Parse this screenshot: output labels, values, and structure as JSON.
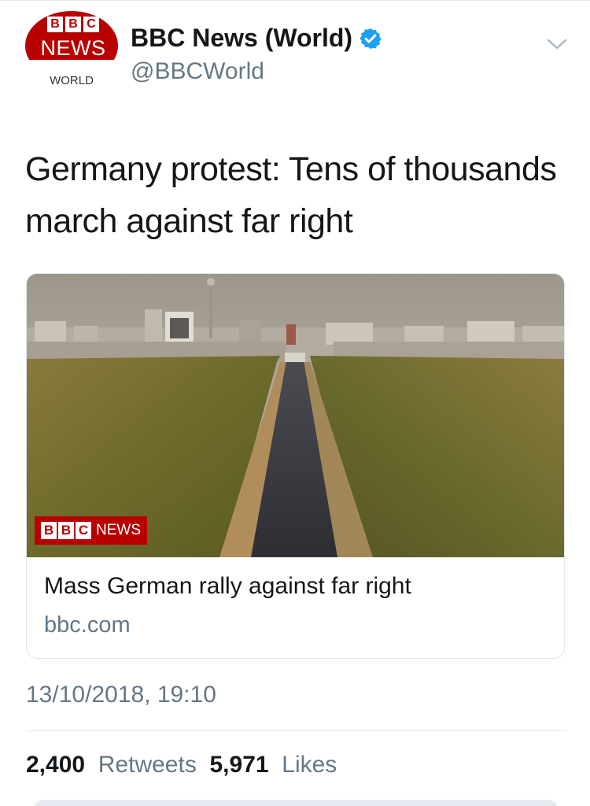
{
  "account": {
    "logo": {
      "top": "BBC",
      "middle": "NEWS",
      "bottom": "WORLD"
    },
    "display_name": "BBC News (World)",
    "handle": "@BBCWorld",
    "verified_icon": "verified-badge-icon",
    "menu_icon": "chevron-down-icon"
  },
  "tweet": {
    "text": "Germany protest: Tens of thousands march against far right"
  },
  "card": {
    "image_badge": {
      "letters": [
        "B",
        "B",
        "C"
      ],
      "word": "NEWS"
    },
    "title": "Mass German rally against far right",
    "domain": "bbc.com"
  },
  "timestamp": "13/10/2018, 19:10",
  "stats": {
    "retweets_count": "2,400",
    "retweets_label": "Retweets",
    "likes_count": "5,971",
    "likes_label": "Likes"
  },
  "colors": {
    "bbc_red": "#b80000",
    "verified_blue": "#1da1f2",
    "secondary_text": "#657786",
    "border": "#e1e8ed"
  }
}
